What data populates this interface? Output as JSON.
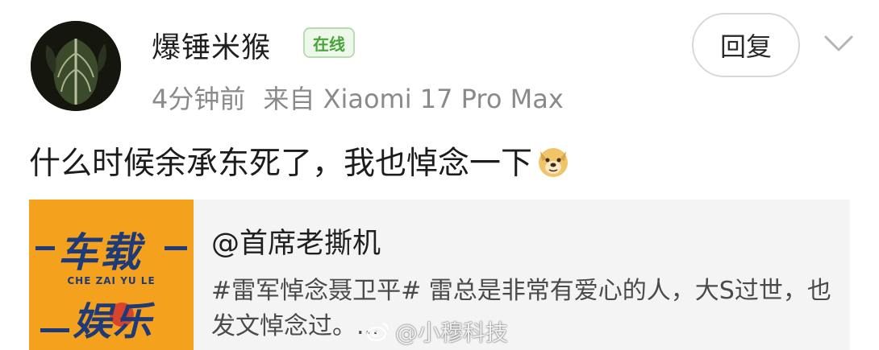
{
  "comment": {
    "username": "爆锤米猴",
    "online_badge": "在线",
    "time": "4分钟前",
    "source": "来自 Xiaomi 17 Pro Max",
    "reply_label": "回复",
    "text": "什么时候余承东死了，我也悼念一下",
    "emoji": "doge-icon"
  },
  "quote": {
    "thumb_title_line1": "车载",
    "thumb_subtitle": "CHE ZAI YU LE",
    "thumb_title_line2": "娱乐",
    "author": "@首席老撕机",
    "text": "#雷军悼念聂卫平# 雷总是非常有爱心的人，大S过世，也发文悼念过。..."
  },
  "watermark": {
    "text": "@小穆科技",
    "icon": "weibo-icon"
  },
  "colors": {
    "online_text": "#4aa33a",
    "meta_text": "#8a8a8a",
    "quote_bg": "#f4f4f4",
    "thumb_bg": "#f4a21e",
    "thumb_text": "#1e3a78"
  }
}
